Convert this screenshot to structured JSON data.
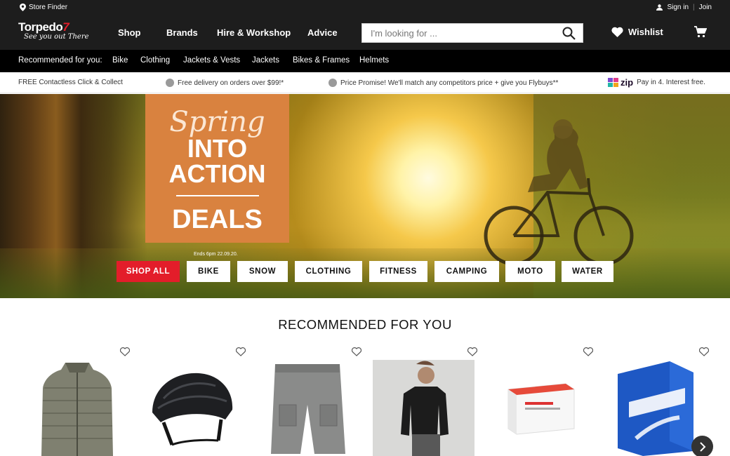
{
  "utility": {
    "store_finder": "Store Finder",
    "sign_in": "Sign in",
    "join": "Join"
  },
  "logo": {
    "brand": "Torpedo",
    "seven": "7",
    "tagline": "See you out There"
  },
  "nav": [
    {
      "label": "Shop"
    },
    {
      "label": "Brands"
    },
    {
      "label": "Hire & Workshop"
    },
    {
      "label": "Advice"
    }
  ],
  "search": {
    "placeholder": "I'm looking for ..."
  },
  "wishlist": {
    "label": "Wishlist"
  },
  "recommended_bar": {
    "label": "Recommended for you:",
    "links": [
      "Bike",
      "Clothing",
      "Jackets & Vests",
      "Jackets",
      "Bikes & Frames",
      "Helmets"
    ]
  },
  "promo_bar": {
    "click_collect": "FREE Contactless Click & Collect",
    "delivery": "Free delivery on orders over $99!*",
    "price_promise": "Price Promise! We'll match any competitors price + give you Flybuys**",
    "zip_brand": "zip",
    "zip_text": "Pay in 4. Interest free."
  },
  "hero": {
    "script": "Spring",
    "line1": "INTO",
    "line2": "ACTION",
    "deals": "DEALS",
    "ends": "Ends 6pm 22.09.20.",
    "buttons": [
      "SHOP ALL",
      "BIKE",
      "SNOW",
      "CLOTHING",
      "FITNESS",
      "CAMPING",
      "MOTO",
      "WATER"
    ]
  },
  "section": {
    "title": "RECOMMENDED FOR YOU"
  },
  "products": [
    {
      "name": "puffer-jacket"
    },
    {
      "name": "bike-helmet"
    },
    {
      "name": "cargo-shorts"
    },
    {
      "name": "black-pullover"
    },
    {
      "name": "tube-box-white"
    },
    {
      "name": "tube-box-blue"
    }
  ],
  "colors": {
    "dark": "#1d1d1d",
    "black": "#000000",
    "red": "#e31d2a",
    "orange": "#d9823f"
  }
}
